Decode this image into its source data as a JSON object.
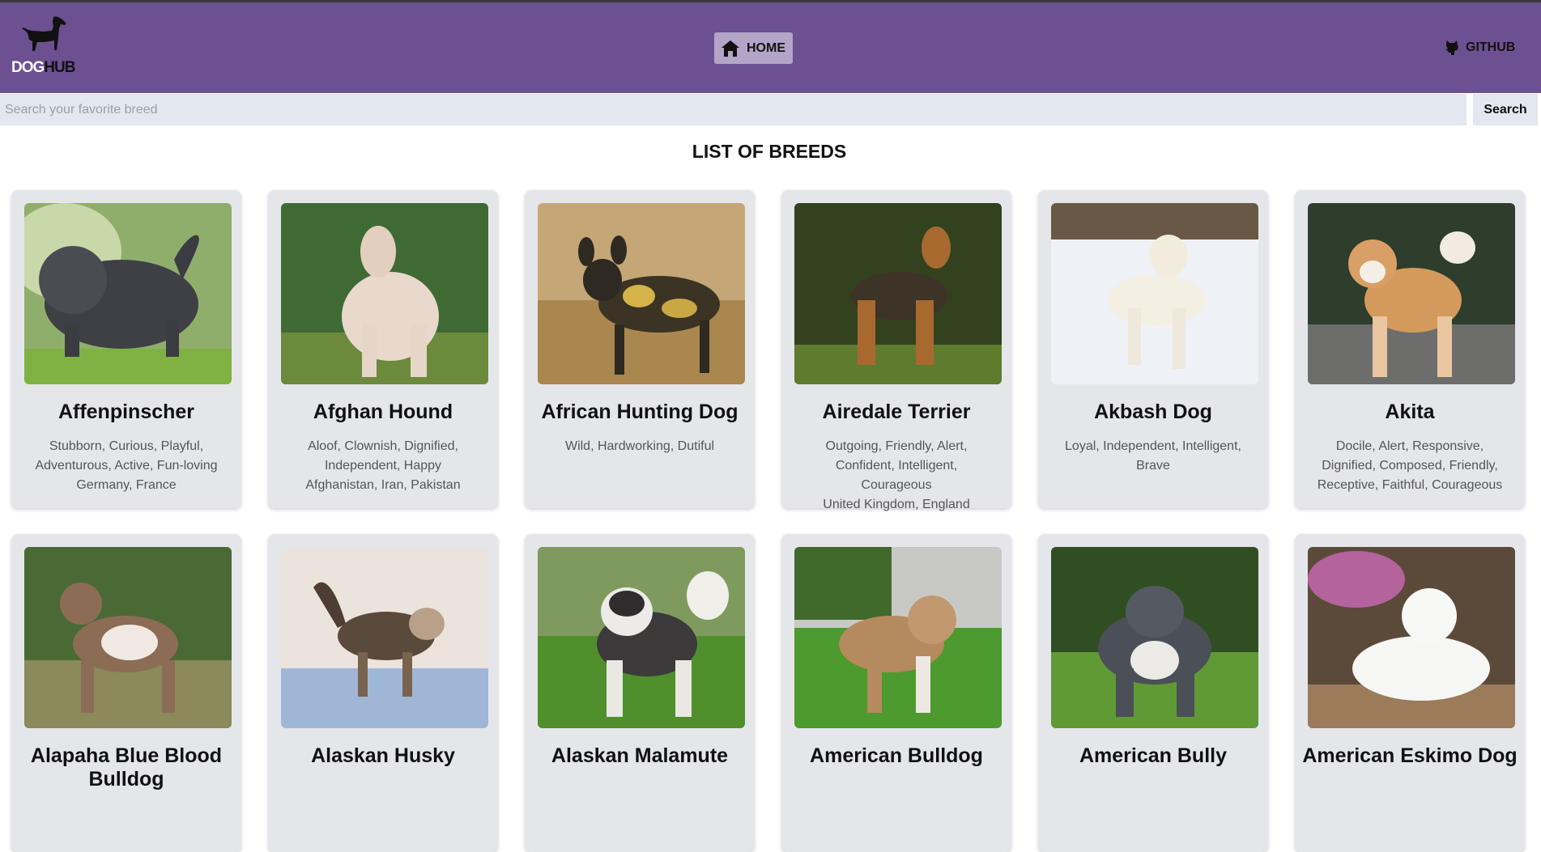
{
  "header": {
    "logo": {
      "part1": "DOG",
      "part2": "HUB",
      "icon": "dog-silhouette-icon"
    },
    "nav": {
      "home_label": "HOME",
      "home_icon": "house-icon",
      "github_label": "GITHUB",
      "github_icon": "github-icon"
    },
    "bg_color": "#6c5091"
  },
  "search": {
    "placeholder": "Search your favorite breed",
    "value": "",
    "button_label": "Search"
  },
  "main": {
    "title": "LIST OF BREEDS",
    "breeds": [
      {
        "name": "Affenpinscher",
        "temperament": "Stubborn, Curious, Playful, Adventurous, Active, Fun-loving",
        "origin": "Germany, France"
      },
      {
        "name": "Afghan Hound",
        "temperament": "Aloof, Clownish, Dignified, Independent, Happy",
        "origin": "Afghanistan, Iran, Pakistan"
      },
      {
        "name": "African Hunting Dog",
        "temperament": "Wild, Hardworking, Dutiful",
        "origin": ""
      },
      {
        "name": "Airedale Terrier",
        "temperament": "Outgoing, Friendly, Alert, Confident, Intelligent, Courageous",
        "origin": "United Kingdom, England"
      },
      {
        "name": "Akbash Dog",
        "temperament": "Loyal, Independent, Intelligent, Brave",
        "origin": ""
      },
      {
        "name": "Akita",
        "temperament": "Docile, Alert, Responsive, Dignified, Composed, Friendly, Receptive, Faithful, Courageous",
        "origin": ""
      },
      {
        "name": "Alapaha Blue Blood Bulldog",
        "temperament": "",
        "origin": ""
      },
      {
        "name": "Alaskan Husky",
        "temperament": "",
        "origin": ""
      },
      {
        "name": "Alaskan Malamute",
        "temperament": "",
        "origin": ""
      },
      {
        "name": "American Bulldog",
        "temperament": "",
        "origin": ""
      },
      {
        "name": "American Bully",
        "temperament": "",
        "origin": ""
      },
      {
        "name": "American Eskimo Dog",
        "temperament": "",
        "origin": ""
      }
    ]
  }
}
